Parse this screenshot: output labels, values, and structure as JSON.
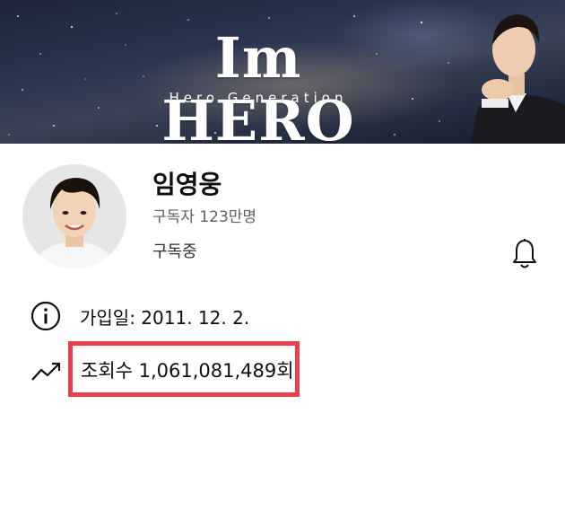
{
  "banner": {
    "title": "Im HERO",
    "subtitle": "Hero Generation"
  },
  "channel": {
    "name": "임영웅",
    "subscribers": "구독자 123만명",
    "subscribe_status": "구독중"
  },
  "about": {
    "joined": "가입일: 2011. 12. 2.",
    "views": "조회수 1,061,081,489회"
  },
  "colors": {
    "highlight_border": "#e8404d",
    "secondary_text": "#606060"
  },
  "icons": {
    "info": "info-circle-icon",
    "views": "trending-arrow-icon",
    "notifications": "bell-icon"
  }
}
